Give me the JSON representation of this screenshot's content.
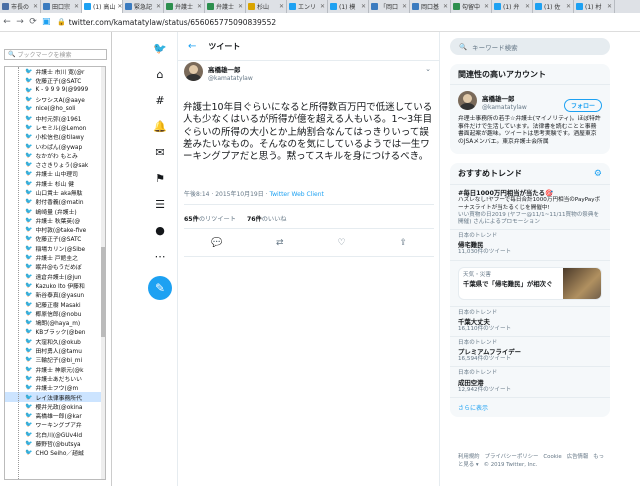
{
  "browser": {
    "tabs": [
      {
        "label": "市長の",
        "color": "#4a6fa5"
      },
      {
        "label": "田口宗",
        "color": "#3b7bbf"
      },
      {
        "label": "(1) 高山",
        "color": "#1da1f2",
        "active": true
      },
      {
        "label": "緊急記",
        "color": "#3b7bbf"
      },
      {
        "label": "弁護士",
        "color": "#2d8f4e"
      },
      {
        "label": "弁護士",
        "color": "#2d8f4e"
      },
      {
        "label": "杉山",
        "color": "#d9a400"
      },
      {
        "label": "エンリ",
        "color": "#1da1f2"
      },
      {
        "label": "(1) 模",
        "color": "#1da1f2"
      },
      {
        "label": "「岡口",
        "color": "#3b7bbf"
      },
      {
        "label": "岡口基",
        "color": "#3b7bbf"
      },
      {
        "label": "勾留中",
        "color": "#2d8f4e"
      },
      {
        "label": "(1) 弁",
        "color": "#1da1f2"
      },
      {
        "label": "(1) 佐",
        "color": "#1da1f2"
      },
      {
        "label": "(1) 村",
        "color": "#1da1f2"
      }
    ],
    "url": "twitter.com/kamatatylaw/status/656065775090839552"
  },
  "bookmarks": {
    "search_placeholder": "ブックマークを検索",
    "items": [
      "弁護士 市川 寛(@r",
      "佐藤正子(@SATC",
      "K - 9 9 9 9(@9999",
      "シワシスA(@aaye",
      "nice(@ho_soli",
      "中村元弥(@1961",
      "レモミル(@Lemon",
      "小松信也(@tilawy",
      "いわぱん(@ywap",
      "なかがわ もとみ",
      "ささきりょう(@sak",
      "弁護士 山中理司",
      "弁護士 杉山 健",
      "山口貴士 aka無駄",
      "射付香義(@matin",
      "嶋崎量 (弁護士)",
      "弁護士 秋葉英(@",
      "中村敦(@take-five",
      "佐藤正子(@SATC",
      "稲場カリン(@Sibe",
      "弁護士 戸館圭之",
      "眠井@もうだめぼ",
      "遠倉弁護士(@jun",
      "Kazuko Ito 伊藤和",
      "新谷泰真(@yasun",
      "紀藤正樹 Masaki",
      "椰原信郎(@nobu",
      "鳩朗(@haya_m)",
      "KBブラック(@ben",
      "大窪和久(@okub",
      "田村勇人(@tamu",
      "三輪記子(@bi_mi",
      "弁護士 神原元(@k",
      "弁護士あだちいい",
      "弁護士フウ(@m",
      "レイ法律事務所代",
      "櫻井光政(@okina",
      "高橋雄一郎(@kar",
      "ワーキングプア弁",
      "北白川(@GUv4ld",
      "藤野哲(@butsya",
      "CHO Seiho／趙誠"
    ],
    "selected_index": 35
  },
  "left_nav": [
    "twitter-bird",
    "home",
    "explore",
    "notifications",
    "messages",
    "bookmarks",
    "lists",
    "profile",
    "more"
  ],
  "timeline": {
    "header": "ツイート",
    "author_name": "高橋雄一郎",
    "author_handle": "@kamatatylaw",
    "text": "弁護士10年目ぐらいになると所得数百万円で低迷している人も少なくはいるが所得が億を超える人もいる。1〜3年目ぐらいの所得の大小とか上納割合なんてはっきりいって誤差みたいなもの。そんなのを気にしているようでは一生ワーキングプアだと思う。黙ってスキルを身につけるべき。",
    "timestamp": "午後8:14 · 2015年10月19日 · ",
    "client": "Twitter Web Client",
    "retweets_count": "65件",
    "retweets_label": "のリツイート",
    "likes_count": "76件",
    "likes_label": "のいいね"
  },
  "sidebar": {
    "search_placeholder": "キーワード検索",
    "related_title": "関連性の高いアカウント",
    "account_name": "高橋雄一郎",
    "account_handle": "@kamatatylaw",
    "follow_label": "フォロー",
    "account_bio": "弁理士事務所の若手☆弁護士(マイノリティ)。ほぼ特許事件だけで生活しています。法律書を読むことと事務書面起案が趣味。ツイートは思考実験です。酒屋東京のJSAメンバエ。東京弁護士会所属",
    "trends_title": "おすすめトレンド",
    "trends": [
      {
        "kind": "promo",
        "name": "#毎日1000万円相当が当たる🎯",
        "desc": "ハズレなし!ヤフーで毎日合計1000万円相当のPayPayボーナスライトが当たるくじを開催中!",
        "meta": "いい買物の日2019 (ヤフー@11/1~11/11買物の祭典を開催) さんによるプロモーション"
      },
      {
        "kind": "trend",
        "label": "日本のトレンド",
        "name": "帰宅難民",
        "count": "11,030件のツイート"
      },
      {
        "kind": "card",
        "label": "天気・災害",
        "name": "千葉県で「帰宅難民」が相次ぐ"
      },
      {
        "kind": "trend",
        "label": "日本のトレンド",
        "name": "千葉大丈夫",
        "count": "16,110件のツイート"
      },
      {
        "kind": "trend",
        "label": "日本のトレンド",
        "name": "プレミアムフライデー",
        "count": "16,594件のツイート"
      },
      {
        "kind": "trend",
        "label": "日本のトレンド",
        "name": "成田空港",
        "count": "12,942件のツイート"
      }
    ],
    "show_more": "さらに表示",
    "footer": [
      "利用規約",
      "プライバシーポリシー",
      "Cookie",
      "広告情報",
      "もっと見る ▾",
      "© 2019 Twitter, Inc."
    ]
  },
  "colors": {
    "accent": "#1da1f2",
    "text": "#14171a",
    "secondary": "#657786",
    "panel": "#f5f8fa"
  }
}
